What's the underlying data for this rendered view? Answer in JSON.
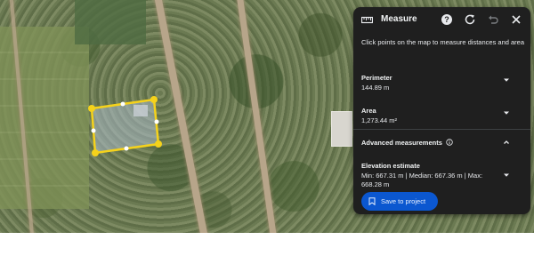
{
  "panel": {
    "title": "Measure",
    "instruction": "Click points on the map to measure distances and area",
    "perimeter": {
      "label": "Perimeter",
      "value": "144.89 m"
    },
    "area": {
      "label": "Area",
      "value": "1,273.44 m²"
    },
    "advanced": {
      "label": "Advanced measurements"
    },
    "elevation": {
      "label": "Elevation estimate",
      "value": "Min: 667.31 m | Median: 667.36 m | Max: 668.28 m"
    },
    "save_label": "Save to project"
  },
  "icons": {
    "ruler": "ruler-icon",
    "help": "help-icon",
    "refresh": "refresh-icon",
    "undo": "undo-icon",
    "close": "close-icon",
    "info": "info-icon",
    "bookmark": "bookmark-icon"
  },
  "colors": {
    "polygon_stroke": "#f5d21b",
    "panel_bg": "#1f1f1f",
    "button_bg": "#0b57d0"
  }
}
